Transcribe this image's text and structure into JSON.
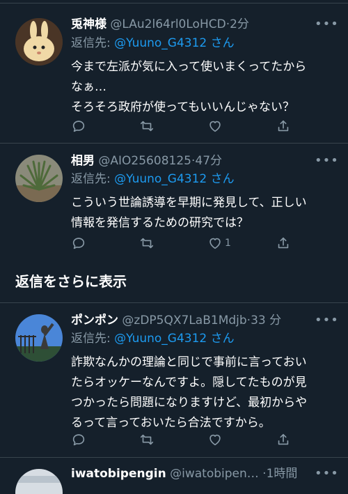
{
  "tweets": [
    {
      "name": "兎神様",
      "handle": "@LAu2l64rl0LoHCD",
      "time": "2分",
      "reply_prefix": "返信先: ",
      "reply_to": "@Yuuno_G4312",
      "reply_suffix": " さん",
      "lines": [
        "今まで左派が気に入って使いまくってたから",
        "なぁ…",
        "そろそろ政府が使ってもいいんじゃない？"
      ],
      "likes": ""
    },
    {
      "name": "相男",
      "handle": "@AIO25608125",
      "time": "47分",
      "reply_prefix": "返信先: ",
      "reply_to": "@Yuuno_G4312",
      "reply_suffix": " さん",
      "lines": [
        "こういう世論誘導を早期に発見して、正しい",
        "情報を発信するための研究では？"
      ],
      "likes": "1"
    },
    {
      "name": "ポンポン",
      "handle": "@zDP5QX7LaB1Mdjb",
      "time": "33 分",
      "reply_prefix": "返信先: ",
      "reply_to": "@Yuuno_G4312",
      "reply_suffix": " さん",
      "lines": [
        "詐欺なんかの理論と同じで事前に言っておい",
        "たらオッケーなんですよ。隠してたものが見",
        "つかったら問題になりますけど、最初からや",
        "るって言っておいたら合法ですから。"
      ],
      "likes": ""
    },
    {
      "name": "iwatobipengin",
      "handle": "@iwatobipen…",
      "time": "1時間"
    }
  ],
  "section": {
    "more_replies": "返信をさらに表示"
  },
  "icons": [
    "reply-icon",
    "retweet-icon",
    "like-icon",
    "share-icon",
    "more-icon"
  ],
  "colors": {
    "background": "#15202b",
    "secondary_text": "#8899a6",
    "accent": "#1d9bf0",
    "divider": "#38444d"
  }
}
